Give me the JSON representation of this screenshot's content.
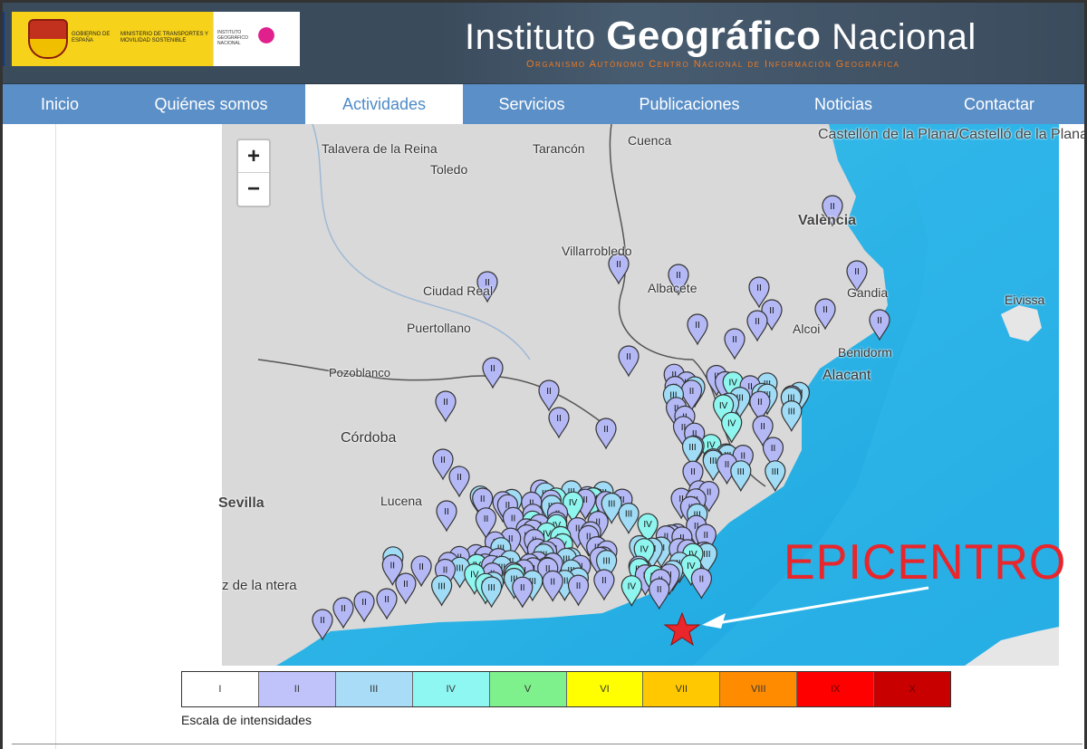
{
  "header": {
    "gov_label_1": "GOBIERNO DE ESPAÑA",
    "gov_label_2": "MINISTERIO DE TRANSPORTES Y MOVILIDAD SOSTENIBLE",
    "ign_label": "INSTITUTO GEOGRÁFICO NACIONAL",
    "title_prefix": "Instituto ",
    "title_bold": "Geográfico",
    "title_suffix": " Nacional",
    "subtitle": "Organismo Autónomo   Centro Nacional de Información Geográfica"
  },
  "nav": {
    "items": [
      {
        "label": "Inicio"
      },
      {
        "label": "Quiénes somos"
      },
      {
        "label": "Actividades",
        "active": true
      },
      {
        "label": "Servicios"
      },
      {
        "label": "Publicaciones"
      },
      {
        "label": "Noticias"
      },
      {
        "label": "Contactar"
      }
    ]
  },
  "map": {
    "zoom_in": "+",
    "zoom_out": "−",
    "cities": [
      "Talavera de la Reina",
      "Tarancón",
      "Cuenca",
      "Castellón de la Plana/Castelló de la Plana",
      "Toledo",
      "València",
      "Villarrobledo",
      "Ciudad Real",
      "Albacete",
      "Gandia",
      "Eivissa",
      "Puertollano",
      "Alcoi",
      "Benidorm",
      "Pozoblanco",
      "Alacant",
      "Córdoba",
      "Sevilla",
      "Lucena",
      "z de la ntera"
    ],
    "epicenter_label": "EPICENTRO",
    "marker_colors": {
      "II": "#b4b9f6",
      "III": "#a0dcf5",
      "IV": "#8ef5ef"
    }
  },
  "legend": {
    "levels": [
      {
        "label": "I",
        "color": "#ffffff"
      },
      {
        "label": "II",
        "color": "#bfc3fa"
      },
      {
        "label": "III",
        "color": "#a8dcf7"
      },
      {
        "label": "IV",
        "color": "#8ff7f2"
      },
      {
        "label": "V",
        "color": "#7ef08c"
      },
      {
        "label": "VI",
        "color": "#ffff00"
      },
      {
        "label": "VII",
        "color": "#ffc800"
      },
      {
        "label": "VIII",
        "color": "#ff8c00"
      },
      {
        "label": "IX",
        "color": "#ff0000"
      },
      {
        "label": "X",
        "color": "#c80000"
      }
    ],
    "caption": "Escala de intensidades"
  }
}
